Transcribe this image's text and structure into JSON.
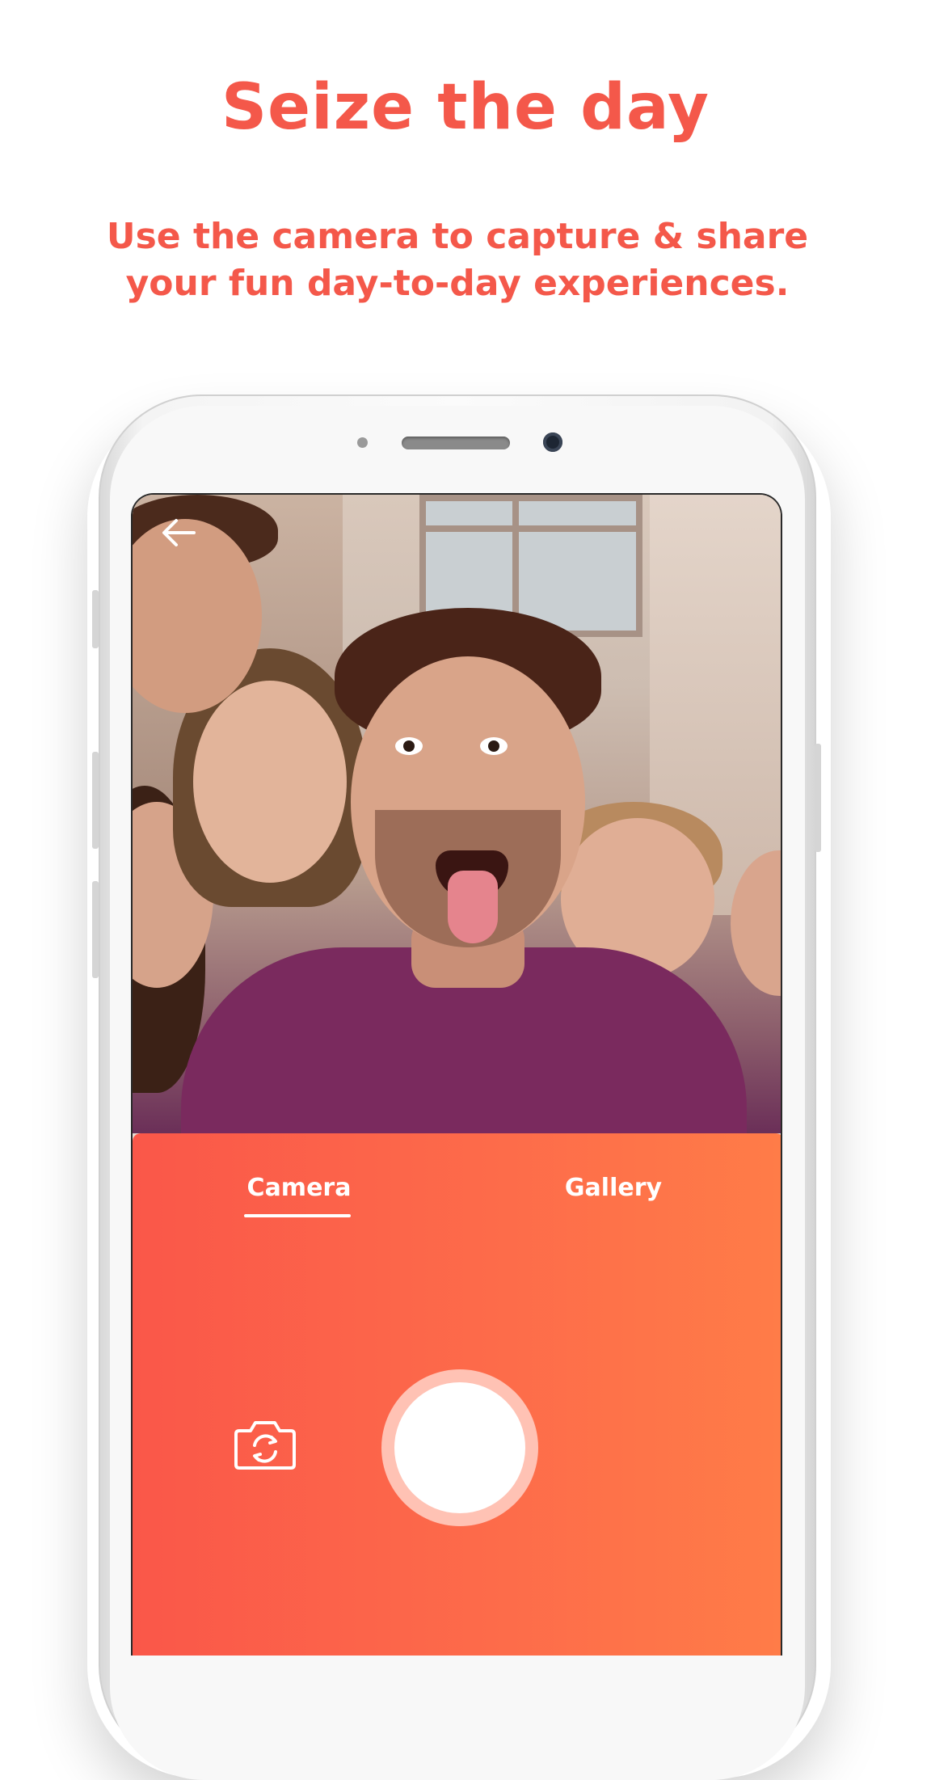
{
  "headline": "Seize the day",
  "subline": "Use the camera to capture & share your fun day-to-day experiences.",
  "camera_screen": {
    "tabs": [
      {
        "label": "Camera",
        "selected": true
      },
      {
        "label": "Gallery",
        "selected": false
      }
    ],
    "icons": {
      "back": "back-arrow-icon",
      "switch_camera": "switch-camera-icon",
      "shutter": "shutter-button"
    }
  },
  "colors": {
    "accent": "#f4584a",
    "panel_gradient_start": "#fa5749",
    "panel_gradient_end": "#ff7c48",
    "shutter_ring": "#ffc2b4"
  }
}
